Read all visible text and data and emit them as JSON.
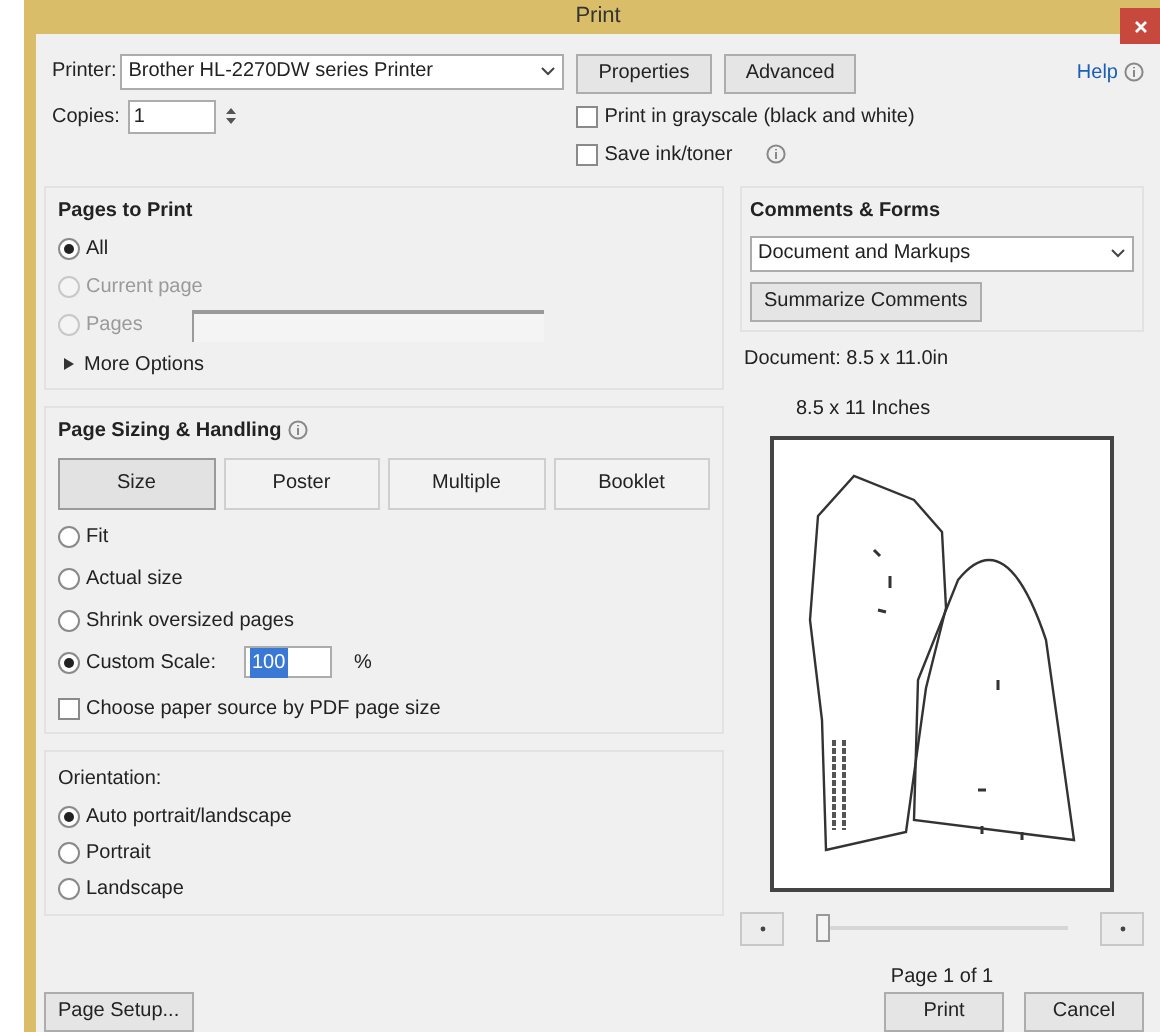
{
  "window": {
    "title": "Print"
  },
  "printer": {
    "label": "Printer:",
    "value": "Brother HL-2270DW series Printer"
  },
  "top_buttons": [
    "Properties",
    "Advanced"
  ],
  "help": "Help",
  "copies": {
    "label": "Copies:",
    "value": "1"
  },
  "options": [
    {
      "label": "Print in grayscale (black and white)",
      "checked": false,
      "info": false
    },
    {
      "label": "Save ink/toner",
      "checked": false,
      "info": true
    }
  ],
  "pages_to_print": {
    "title": "Pages to Print",
    "choices": [
      {
        "label": "All",
        "selected": true,
        "disabled": false
      },
      {
        "label": "Current page",
        "selected": false,
        "disabled": true
      },
      {
        "label": "Pages",
        "selected": false,
        "disabled": true
      }
    ],
    "more_options": "More Options"
  },
  "sizing": {
    "title": "Page Sizing & Handling",
    "modes": [
      {
        "label": "Size",
        "selected": true
      },
      {
        "label": "Poster",
        "selected": false
      },
      {
        "label": "Multiple",
        "selected": false
      },
      {
        "label": "Booklet",
        "selected": false
      }
    ],
    "choices": [
      {
        "label": "Fit",
        "selected": false
      },
      {
        "label": "Actual size",
        "selected": false
      },
      {
        "label": "Shrink oversized pages",
        "selected": false
      },
      {
        "label": "Custom Scale:",
        "selected": true
      }
    ],
    "scale": "100",
    "unit": "%",
    "paper_source": {
      "label": "Choose paper source by PDF page size",
      "checked": false
    }
  },
  "orientation": {
    "title": "Orientation:",
    "choices": [
      {
        "label": "Auto portrait/landscape",
        "selected": true
      },
      {
        "label": "Portrait",
        "selected": false
      },
      {
        "label": "Landscape",
        "selected": false
      }
    ]
  },
  "comments": {
    "title": "Comments & Forms",
    "value": "Document and Markups",
    "summarize": "Summarize Comments"
  },
  "preview": {
    "document": "Document: 8.5 x 11.0in",
    "paper": "8.5 x 11 Inches",
    "level": 0,
    "page": "Page 1 of 1"
  },
  "page_setup": "Page Setup...",
  "actions": [
    "Print",
    "Cancel"
  ]
}
